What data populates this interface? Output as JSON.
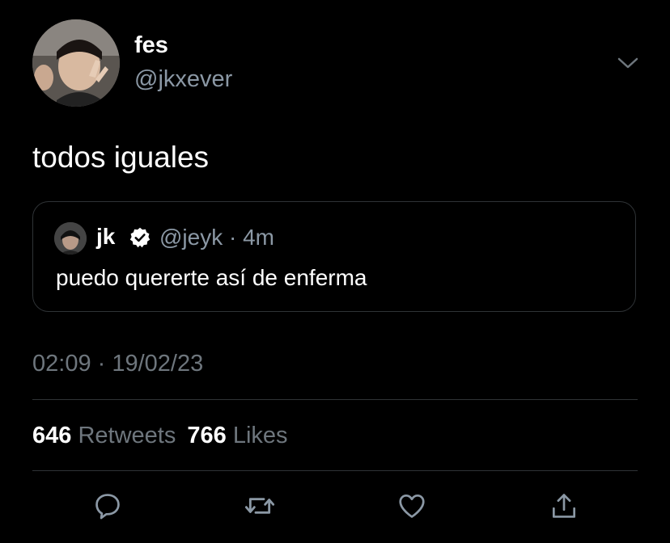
{
  "author": {
    "display_name": "fes",
    "handle": "@jkxever",
    "avatar": "profile-photo"
  },
  "tweet": {
    "text": "todos iguales",
    "timestamp": "02:09 · 19/02/23"
  },
  "quoted_tweet": {
    "display_name": "jk",
    "verified": true,
    "meta": "@jeyk · 4m",
    "text": "puedo quererte así de enferma"
  },
  "stats": {
    "retweets_count": "646",
    "retweets_label": "Retweets",
    "likes_count": "766",
    "likes_label": "Likes"
  },
  "actions": [
    "reply-icon",
    "retweet-icon",
    "like-icon",
    "share-icon"
  ],
  "colors": {
    "background": "#000000",
    "text_primary": "#ffffff",
    "text_secondary": "#8b98a5",
    "divider": "#2f3336"
  }
}
